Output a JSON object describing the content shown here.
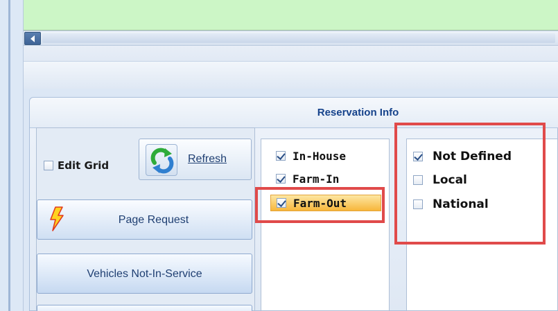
{
  "panel": {
    "title": "Reservation Info"
  },
  "left_controls": {
    "edit_grid": {
      "label": "Edit Grid",
      "checked": false
    },
    "refresh_label": "Refresh",
    "page_request_label": "Page Request",
    "vehicles_label": "Vehicles Not-In-Service"
  },
  "source_list": [
    {
      "label": "In-House",
      "checked": true,
      "selected": false
    },
    {
      "label": "Farm-In",
      "checked": true,
      "selected": false
    },
    {
      "label": "Farm-Out",
      "checked": true,
      "selected": true
    }
  ],
  "type_list": [
    {
      "label": "Not Defined",
      "checked": true
    },
    {
      "label": "Local",
      "checked": false
    },
    {
      "label": "National",
      "checked": false
    }
  ],
  "colors": {
    "grid_row": "#ccf6c6",
    "accent_text": "#15428b",
    "selected_item": "#f7b63b",
    "highlight_box": "#e04a4a"
  },
  "icons": [
    "scroll-left-arrow-icon",
    "refresh-arrows-icon",
    "lightning-bolt-icon",
    "checkbox-icon"
  ]
}
